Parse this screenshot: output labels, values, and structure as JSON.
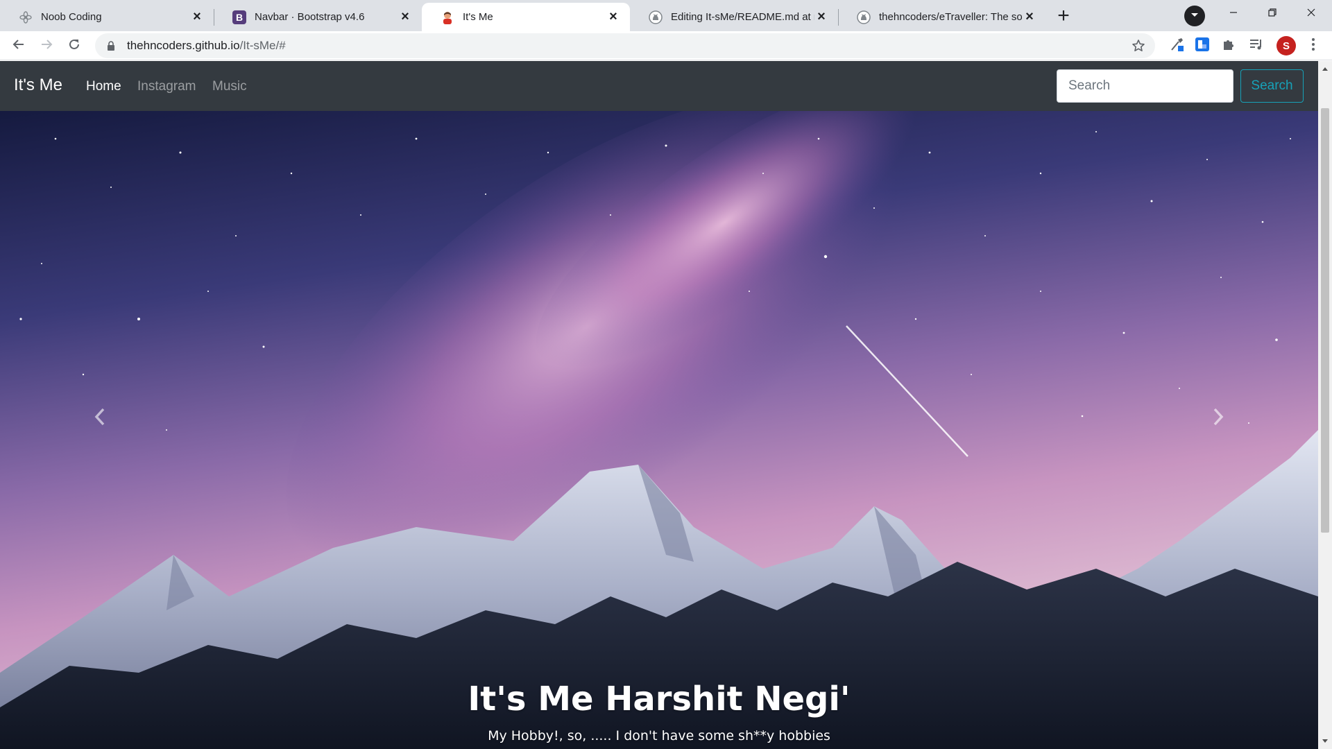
{
  "browser": {
    "tabs": [
      {
        "title": "Noob Coding",
        "icon": "flower-logo-icon",
        "active": false
      },
      {
        "title": "Navbar · Bootstrap v4.6",
        "icon": "bootstrap-logo-icon",
        "active": false
      },
      {
        "title": "It's Me",
        "icon": "avatar-favicon-icon",
        "active": true
      },
      {
        "title": "Editing It-sMe/README.md at m",
        "icon": "github-logo-icon",
        "active": false
      },
      {
        "title": "thehncoders/eTraveller: The softw",
        "icon": "github-logo-icon",
        "active": false
      }
    ],
    "bootstrap_icon_letter": "B",
    "url": {
      "host": "thehncoders.github.io",
      "path": "/It-sMe/#"
    },
    "profile_initial": "S",
    "colors": {
      "tabstrip": "#dee1e6",
      "profile": "#c5221f"
    }
  },
  "site": {
    "brand": "It's Me",
    "nav": [
      "Home",
      "Instagram",
      "Music"
    ],
    "active_nav": "Home",
    "search_placeholder": "Search",
    "search_button": "Search",
    "colors": {
      "navbar": "#343a40",
      "search_accent": "#17a2b8"
    }
  },
  "carousel": {
    "heading": "It's Me Harshit Negi'",
    "text": "My Hobby!, so, ..... I don't have some sh**y hobbies",
    "slide_count": 2,
    "active_slide": 1
  }
}
